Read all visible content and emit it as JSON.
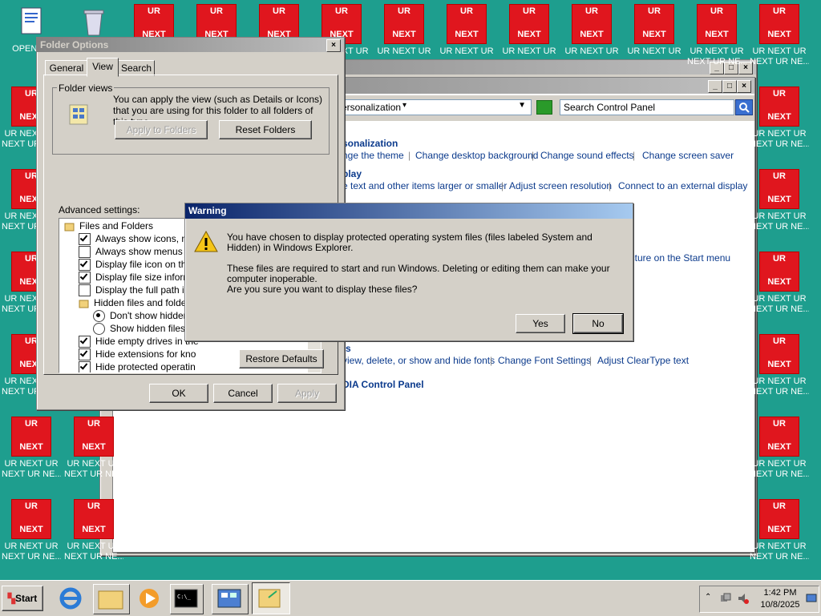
{
  "desktop": {
    "tile_top": "UR",
    "tile_bottom": "NEXT",
    "caption_a": "UR NEXT UR",
    "caption_b": "NEXT UR NE...",
    "openme_caption": "OPENME"
  },
  "control_panel": {
    "breadcrumb": "ersonalization",
    "search_placeholder": "Search Control Panel",
    "sections": [
      {
        "title": "sonalization",
        "links": [
          "nge the theme",
          "Change desktop background",
          "Change sound effects",
          "Change screen saver"
        ]
      },
      {
        "title": "play",
        "links": [
          "e text and other items larger or smaller",
          "Adjust screen resolution",
          "Connect to an external display"
        ]
      },
      {
        "title": "",
        "links": [
          "icture on the Start menu"
        ]
      },
      {
        "title": "ts",
        "links": [
          "view, delete, or show and hide fonts",
          "Change Font Settings",
          "Adjust ClearType text"
        ]
      },
      {
        "title": "DIA Control Panel",
        "links": []
      }
    ]
  },
  "folder_options": {
    "title": "Folder Options",
    "tabs": [
      "General",
      "View",
      "Search"
    ],
    "folder_views_label": "Folder views",
    "folder_views_desc": "You can apply the view (such as Details or Icons) that you are using for this folder to all folders of this type.",
    "apply_to_folders": "Apply to Folders",
    "reset_folders": "Reset Folders",
    "advanced_label": "Advanced settings:",
    "items": [
      {
        "kind": "folder",
        "label": "Files and Folders"
      },
      {
        "kind": "check",
        "checked": true,
        "label": "Always show icons, never thumbnails"
      },
      {
        "kind": "check",
        "checked": false,
        "label": "Always show menus"
      },
      {
        "kind": "check",
        "checked": true,
        "label": "Display file icon on thun"
      },
      {
        "kind": "check",
        "checked": true,
        "label": "Display file size informat"
      },
      {
        "kind": "check",
        "checked": false,
        "label": "Display the full path in th"
      },
      {
        "kind": "folder",
        "label": "Hidden files and folders"
      },
      {
        "kind": "radio",
        "checked": true,
        "label": "Don't show hidden"
      },
      {
        "kind": "radio",
        "checked": false,
        "label": "Show hidden files, f"
      },
      {
        "kind": "check",
        "checked": true,
        "label": "Hide empty drives in the"
      },
      {
        "kind": "check",
        "checked": true,
        "label": "Hide extensions for kno"
      },
      {
        "kind": "check",
        "checked": true,
        "label": "Hide protected operatin"
      }
    ],
    "restore_defaults": "Restore Defaults",
    "ok": "OK",
    "cancel": "Cancel",
    "apply": "Apply"
  },
  "warning": {
    "title": "Warning",
    "line1": "You have chosen to display protected operating system files (files labeled System and Hidden) in Windows Explorer.",
    "line2": "These files are required to start and run Windows. Deleting or editing them can make your computer inoperable.",
    "line3": "Are you sure you want to display these files?",
    "yes": "Yes",
    "no": "No"
  },
  "taskbar": {
    "start": "Start",
    "time": "1:42 PM",
    "date": "10/8/2025"
  },
  "colors": {
    "desktop": "#1e9e8e",
    "tile": "#e0161e",
    "title_active": "#0a246a",
    "link": "#0b3a8c"
  }
}
